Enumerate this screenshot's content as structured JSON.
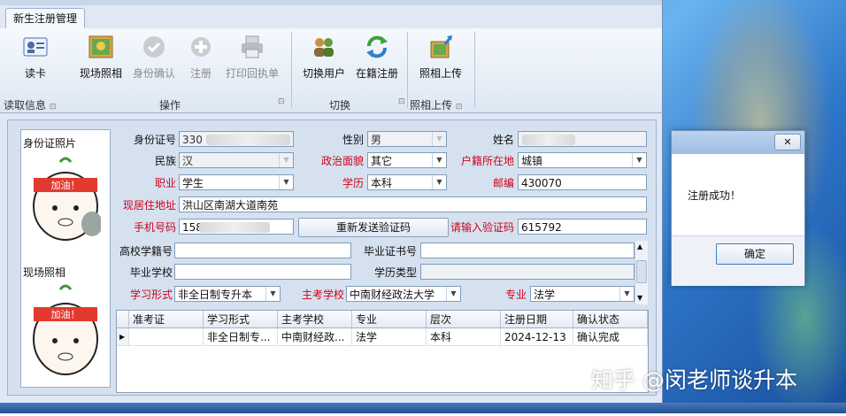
{
  "window": {
    "tab": "新生注册管理"
  },
  "ribbon": {
    "buttons": [
      {
        "label": "读卡",
        "enabled": true,
        "icon": "id-card-icon"
      },
      {
        "label": "现场照相",
        "enabled": true,
        "icon": "photo-icon"
      },
      {
        "label": "身份确认",
        "enabled": false,
        "icon": "check-circle-icon"
      },
      {
        "label": "注册",
        "enabled": false,
        "icon": "plus-circle-icon"
      },
      {
        "label": "打印回执单",
        "enabled": false,
        "icon": "printer-icon"
      },
      {
        "label": "切换用户",
        "enabled": true,
        "icon": "users-icon"
      },
      {
        "label": "在籍注册",
        "enabled": true,
        "icon": "refresh-icon"
      },
      {
        "label": "照相上传",
        "enabled": true,
        "icon": "upload-icon"
      }
    ],
    "groups": [
      "读取信息",
      "操作",
      "切换",
      "照相上传"
    ]
  },
  "photos": {
    "id_label": "身份证照片",
    "live_label": "现场照相",
    "sticker_text": "加油！"
  },
  "form": {
    "id_label": "身份证号",
    "id_value": "330",
    "gender_label": "性别",
    "gender_value": "男",
    "name_label": "姓名",
    "ethnic_label": "民族",
    "ethnic_value": "汉",
    "politics_label": "政治面貌",
    "politics_value": "其它",
    "hukou_label": "户籍所在地",
    "hukou_value": "城镇",
    "job_label": "职业",
    "job_value": "学生",
    "edu_label": "学历",
    "edu_value": "本科",
    "zip_label": "邮编",
    "zip_value": "430070",
    "addr_label": "现居住地址",
    "addr_value": "洪山区南湖大道南苑",
    "phone_label": "手机号码",
    "phone_value": "158",
    "resend_label": "重新发送验证码",
    "code_label": "请输入验证码",
    "code_value": "615792",
    "school_no_label": "高校学籍号",
    "school_no_value": "",
    "cert_label": "毕业证书号",
    "cert_value": "",
    "grad_school_label": "毕业学校",
    "grad_school_value": "",
    "edu_type_label": "学历类型",
    "edu_type_value": "",
    "study_form_label": "学习形式",
    "study_form_value": "非全日制专升本",
    "main_school_label": "主考学校",
    "main_school_value": "中南财经政法大学",
    "major_label": "专业",
    "major_value": "法学"
  },
  "table": {
    "headers": [
      "准考证",
      "学习形式",
      "主考学校",
      "专业",
      "层次",
      "注册日期",
      "确认状态"
    ],
    "rows": [
      [
        "",
        "非全日制专...",
        "中南财经政...",
        "法学",
        "本科",
        "2024-12-13",
        "确认完成"
      ]
    ]
  },
  "dialog": {
    "close_icon": "✕",
    "message": "注册成功！",
    "ok_label": "确定"
  },
  "watermark": "知乎 @闵老师谈升本",
  "colors": {
    "required_label": "#d0021b",
    "window_bg": "#dfe8f4"
  }
}
